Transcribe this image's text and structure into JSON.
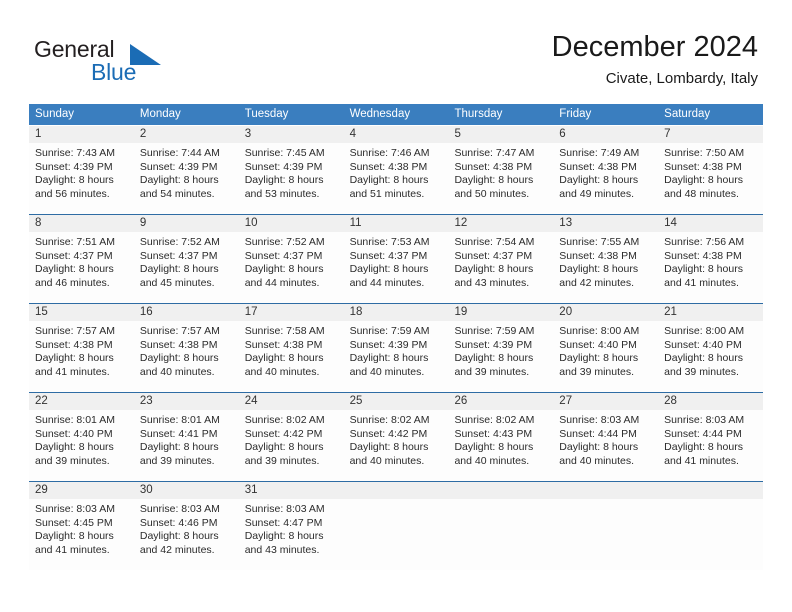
{
  "logo": {
    "word_one": "General",
    "word_two": "Blue",
    "triangle_icon": "triangle-icon"
  },
  "header": {
    "title": "December 2024",
    "subtitle": "Civate, Lombardy, Italy"
  },
  "colors": {
    "header_blue": "#3a7ebf",
    "separator_blue": "#2e6ca4",
    "daynum_band": "#f0f0f0",
    "logo_blue": "#1b6cb5",
    "text": "#222222"
  },
  "calendar": {
    "weekdays": [
      "Sunday",
      "Monday",
      "Tuesday",
      "Wednesday",
      "Thursday",
      "Friday",
      "Saturday"
    ],
    "weeks": [
      {
        "days": [
          {
            "num": "1",
            "lines": [
              "Sunrise: 7:43 AM",
              "Sunset: 4:39 PM",
              "Daylight: 8 hours",
              "and 56 minutes."
            ]
          },
          {
            "num": "2",
            "lines": [
              "Sunrise: 7:44 AM",
              "Sunset: 4:39 PM",
              "Daylight: 8 hours",
              "and 54 minutes."
            ]
          },
          {
            "num": "3",
            "lines": [
              "Sunrise: 7:45 AM",
              "Sunset: 4:39 PM",
              "Daylight: 8 hours",
              "and 53 minutes."
            ]
          },
          {
            "num": "4",
            "lines": [
              "Sunrise: 7:46 AM",
              "Sunset: 4:38 PM",
              "Daylight: 8 hours",
              "and 51 minutes."
            ]
          },
          {
            "num": "5",
            "lines": [
              "Sunrise: 7:47 AM",
              "Sunset: 4:38 PM",
              "Daylight: 8 hours",
              "and 50 minutes."
            ]
          },
          {
            "num": "6",
            "lines": [
              "Sunrise: 7:49 AM",
              "Sunset: 4:38 PM",
              "Daylight: 8 hours",
              "and 49 minutes."
            ]
          },
          {
            "num": "7",
            "lines": [
              "Sunrise: 7:50 AM",
              "Sunset: 4:38 PM",
              "Daylight: 8 hours",
              "and 48 minutes."
            ]
          }
        ]
      },
      {
        "days": [
          {
            "num": "8",
            "lines": [
              "Sunrise: 7:51 AM",
              "Sunset: 4:37 PM",
              "Daylight: 8 hours",
              "and 46 minutes."
            ]
          },
          {
            "num": "9",
            "lines": [
              "Sunrise: 7:52 AM",
              "Sunset: 4:37 PM",
              "Daylight: 8 hours",
              "and 45 minutes."
            ]
          },
          {
            "num": "10",
            "lines": [
              "Sunrise: 7:52 AM",
              "Sunset: 4:37 PM",
              "Daylight: 8 hours",
              "and 44 minutes."
            ]
          },
          {
            "num": "11",
            "lines": [
              "Sunrise: 7:53 AM",
              "Sunset: 4:37 PM",
              "Daylight: 8 hours",
              "and 44 minutes."
            ]
          },
          {
            "num": "12",
            "lines": [
              "Sunrise: 7:54 AM",
              "Sunset: 4:37 PM",
              "Daylight: 8 hours",
              "and 43 minutes."
            ]
          },
          {
            "num": "13",
            "lines": [
              "Sunrise: 7:55 AM",
              "Sunset: 4:38 PM",
              "Daylight: 8 hours",
              "and 42 minutes."
            ]
          },
          {
            "num": "14",
            "lines": [
              "Sunrise: 7:56 AM",
              "Sunset: 4:38 PM",
              "Daylight: 8 hours",
              "and 41 minutes."
            ]
          }
        ]
      },
      {
        "days": [
          {
            "num": "15",
            "lines": [
              "Sunrise: 7:57 AM",
              "Sunset: 4:38 PM",
              "Daylight: 8 hours",
              "and 41 minutes."
            ]
          },
          {
            "num": "16",
            "lines": [
              "Sunrise: 7:57 AM",
              "Sunset: 4:38 PM",
              "Daylight: 8 hours",
              "and 40 minutes."
            ]
          },
          {
            "num": "17",
            "lines": [
              "Sunrise: 7:58 AM",
              "Sunset: 4:38 PM",
              "Daylight: 8 hours",
              "and 40 minutes."
            ]
          },
          {
            "num": "18",
            "lines": [
              "Sunrise: 7:59 AM",
              "Sunset: 4:39 PM",
              "Daylight: 8 hours",
              "and 40 minutes."
            ]
          },
          {
            "num": "19",
            "lines": [
              "Sunrise: 7:59 AM",
              "Sunset: 4:39 PM",
              "Daylight: 8 hours",
              "and 39 minutes."
            ]
          },
          {
            "num": "20",
            "lines": [
              "Sunrise: 8:00 AM",
              "Sunset: 4:40 PM",
              "Daylight: 8 hours",
              "and 39 minutes."
            ]
          },
          {
            "num": "21",
            "lines": [
              "Sunrise: 8:00 AM",
              "Sunset: 4:40 PM",
              "Daylight: 8 hours",
              "and 39 minutes."
            ]
          }
        ]
      },
      {
        "days": [
          {
            "num": "22",
            "lines": [
              "Sunrise: 8:01 AM",
              "Sunset: 4:40 PM",
              "Daylight: 8 hours",
              "and 39 minutes."
            ]
          },
          {
            "num": "23",
            "lines": [
              "Sunrise: 8:01 AM",
              "Sunset: 4:41 PM",
              "Daylight: 8 hours",
              "and 39 minutes."
            ]
          },
          {
            "num": "24",
            "lines": [
              "Sunrise: 8:02 AM",
              "Sunset: 4:42 PM",
              "Daylight: 8 hours",
              "and 39 minutes."
            ]
          },
          {
            "num": "25",
            "lines": [
              "Sunrise: 8:02 AM",
              "Sunset: 4:42 PM",
              "Daylight: 8 hours",
              "and 40 minutes."
            ]
          },
          {
            "num": "26",
            "lines": [
              "Sunrise: 8:02 AM",
              "Sunset: 4:43 PM",
              "Daylight: 8 hours",
              "and 40 minutes."
            ]
          },
          {
            "num": "27",
            "lines": [
              "Sunrise: 8:03 AM",
              "Sunset: 4:44 PM",
              "Daylight: 8 hours",
              "and 40 minutes."
            ]
          },
          {
            "num": "28",
            "lines": [
              "Sunrise: 8:03 AM",
              "Sunset: 4:44 PM",
              "Daylight: 8 hours",
              "and 41 minutes."
            ]
          }
        ]
      },
      {
        "days": [
          {
            "num": "29",
            "lines": [
              "Sunrise: 8:03 AM",
              "Sunset: 4:45 PM",
              "Daylight: 8 hours",
              "and 41 minutes."
            ]
          },
          {
            "num": "30",
            "lines": [
              "Sunrise: 8:03 AM",
              "Sunset: 4:46 PM",
              "Daylight: 8 hours",
              "and 42 minutes."
            ]
          },
          {
            "num": "31",
            "lines": [
              "Sunrise: 8:03 AM",
              "Sunset: 4:47 PM",
              "Daylight: 8 hours",
              "and 43 minutes."
            ]
          },
          {
            "num": "",
            "lines": []
          },
          {
            "num": "",
            "lines": []
          },
          {
            "num": "",
            "lines": []
          },
          {
            "num": "",
            "lines": []
          }
        ]
      }
    ]
  }
}
